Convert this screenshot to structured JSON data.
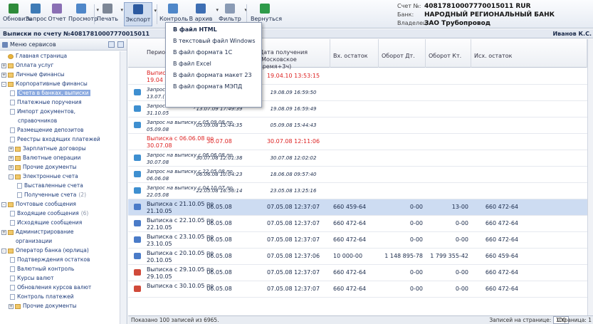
{
  "toolbar": {
    "buttons": [
      {
        "label": "Обновить",
        "color": "#2e8b3a"
      },
      {
        "label": "Запрос",
        "color": "#3e7bb6"
      },
      {
        "label": "Отчет",
        "color": "#8a6fb4"
      },
      {
        "label": "Просмотр",
        "color": "#4f87c9"
      },
      {
        "label": "Печать",
        "color": "#7d8796"
      },
      {
        "label": "Экспорт",
        "color": "#2c5aa0"
      },
      {
        "label": "Контроль",
        "color": "#4f87c9"
      },
      {
        "label": "В архив",
        "color": "#3e6fb4"
      },
      {
        "label": "Фильтр",
        "color": "#8a9bb5"
      },
      {
        "label": "Вернуться",
        "color": "#2e9b4a"
      }
    ]
  },
  "account": {
    "number_label": "Счет №:",
    "number": "40817810007770015011 RUR",
    "bank_label": "Банк:",
    "bank": "НАРОДНЫЙ РЕГИОНАЛЬНЫЙ БАНК",
    "owner_label": "Владелец:",
    "owner": "ЗАО Трубопровод"
  },
  "title": "Выписки по счету №40817810007770015011",
  "user": "Иванов К.С.",
  "export_menu": [
    "В файл HTML",
    "В текстовый файл Windows",
    "В файл формата 1С",
    "В файл Excel",
    "В файл формата макет 23",
    "В файл формата МЭПД"
  ],
  "sidebar": {
    "header": "Меню сервисов",
    "items": [
      {
        "label": "Главная страница",
        "lvl": 0,
        "icon": "star",
        "pm": ""
      },
      {
        "label": "Оплата услуг",
        "lvl": 0,
        "icon": "folder",
        "pm": "+"
      },
      {
        "label": "Личные финансы",
        "lvl": 0,
        "icon": "folder",
        "pm": "+"
      },
      {
        "label": "Корпоративные финансы",
        "lvl": 0,
        "icon": "folder",
        "pm": "-"
      },
      {
        "label": "Счета в банках, выписки",
        "lvl": 1,
        "icon": "page",
        "sel": true
      },
      {
        "label": "Платежные поручения",
        "lvl": 1,
        "icon": "page"
      },
      {
        "label": "Импорт документов,",
        "lvl": 1,
        "icon": "page"
      },
      {
        "label": "справочников",
        "lvl": 1,
        "icon": ""
      },
      {
        "label": "Размещение депозитов",
        "lvl": 1,
        "icon": "page"
      },
      {
        "label": "Реестры входящих платежей",
        "lvl": 1,
        "icon": "page"
      },
      {
        "label": "Зарплатные договоры",
        "lvl": 1,
        "icon": "folder",
        "pm": "+"
      },
      {
        "label": "Валютные операции",
        "lvl": 1,
        "icon": "folder",
        "pm": "+"
      },
      {
        "label": "Прочие документы",
        "lvl": 1,
        "icon": "folder",
        "pm": "+"
      },
      {
        "label": "Электронные счета",
        "lvl": 1,
        "icon": "folder",
        "pm": "-"
      },
      {
        "label": "Выставленные счета",
        "lvl": 2,
        "icon": "page"
      },
      {
        "label": "Полученные счета",
        "lvl": 2,
        "icon": "page",
        "count": "(2)"
      },
      {
        "label": "Почтовые сообщения",
        "lvl": 0,
        "icon": "folder",
        "pm": "-"
      },
      {
        "label": "Входящие сообщения",
        "lvl": 1,
        "icon": "page",
        "count": "(6)"
      },
      {
        "label": "Исходящие сообщения",
        "lvl": 1,
        "icon": "page"
      },
      {
        "label": "Администрирование",
        "lvl": 0,
        "icon": "folder",
        "pm": "+"
      },
      {
        "label": "организации",
        "lvl": 0,
        "icon": ""
      },
      {
        "label": "Оператор банка (юрлица)",
        "lvl": 0,
        "icon": "folder",
        "pm": "-"
      },
      {
        "label": "Подтверждения остатков",
        "lvl": 1,
        "icon": "page"
      },
      {
        "label": "Валютный контроль",
        "lvl": 1,
        "icon": "page"
      },
      {
        "label": "Курсы валют",
        "lvl": 1,
        "icon": "page"
      },
      {
        "label": "Обновления курсов валют",
        "lvl": 1,
        "icon": "page"
      },
      {
        "label": "Контроль платежей",
        "lvl": 1,
        "icon": "page"
      },
      {
        "label": "Прочие документы",
        "lvl": 1,
        "icon": "folder",
        "pm": "+"
      }
    ]
  },
  "grid": {
    "columns": [
      "Период",
      "Дата формирования (Московское время+3ч)",
      "Дата получения (Московское время+3ч)",
      "Вх. остаток",
      "Оборот Дт.",
      "Оборот Кт.",
      "Исх. остаток"
    ],
    "rows": [
      {
        "icon": "none",
        "period": "Выписк",
        "period2": "19.04",
        "formed": "19.04.10",
        "received": "19.04.10 13:53:15",
        "in": "",
        "dt": "",
        "kt": "",
        "out": "",
        "style": "red"
      },
      {
        "icon": "send",
        "period": "Запрос",
        "period2": "13.07.(",
        "formed": "13.07.09 18:37:05",
        "received": "19.08.09 16:59:50",
        "in": "",
        "dt": "",
        "kt": "",
        "out": "",
        "style": "it"
      },
      {
        "icon": "send",
        "period": "Запрос на выписку с 31.10.05 по",
        "period2": "31.10.05",
        "formed": "13.07.09 17:49:39",
        "received": "19.08.09 16:59:49",
        "in": "",
        "dt": "",
        "kt": "",
        "out": "",
        "style": "it"
      },
      {
        "icon": "send",
        "period": "Запрос на выписку с 05.09.08 по",
        "period2": "05.09.08",
        "formed": "05.09.08 15:44:35",
        "received": "05.09.08 15:44:43",
        "in": "",
        "dt": "",
        "kt": "",
        "out": "",
        "style": "it"
      },
      {
        "icon": "none",
        "period": "Выписка с 06.06.08 по",
        "period2": "30.07.08",
        "formed": "30.07.08",
        "received": "30.07.08 12:11:06",
        "in": "",
        "dt": "",
        "kt": "",
        "out": "",
        "style": "red"
      },
      {
        "icon": "send",
        "period": "Запрос на выписку с 06.06.08 по",
        "period2": "30.07.08",
        "formed": "30.07.08 12:01:38",
        "received": "30.07.08 12:02:02",
        "in": "",
        "dt": "",
        "kt": "",
        "out": "",
        "style": "it"
      },
      {
        "icon": "send",
        "period": "Запрос на выписку с 22.05.08 по",
        "period2": "06.06.08",
        "formed": "06.06.08 10:04:23",
        "received": "18.06.08 09:57:40",
        "in": "",
        "dt": "",
        "kt": "",
        "out": "",
        "style": "it"
      },
      {
        "icon": "send",
        "period": "Запрос на выписку с 04.10.07 по",
        "period2": "22.05.08",
        "formed": "22.05.08 16:56:14",
        "received": "23.05.08 13:25:16",
        "in": "",
        "dt": "",
        "kt": "",
        "out": "",
        "style": "it"
      },
      {
        "icon": "doc",
        "period": "Выписка с 21.10.05 по",
        "period2": "21.10.05",
        "formed": "06.05.08",
        "received": "07.05.08 12:37:07",
        "in": "660 459-64",
        "dt": "0-00",
        "kt": "13-00",
        "out": "660 472-64",
        "style": "sel"
      },
      {
        "icon": "doc",
        "period": "Выписка с 22.10.05 по",
        "period2": "22.10.05",
        "formed": "06.05.08",
        "received": "07.05.08 12:37:07",
        "in": "660 472-64",
        "dt": "0-00",
        "kt": "0-00",
        "out": "660 472-64",
        "style": ""
      },
      {
        "icon": "doc",
        "period": "Выписка с 23.10.05 по",
        "period2": "23.10.05",
        "formed": "06.05.08",
        "received": "07.05.08 12:37:07",
        "in": "660 472-64",
        "dt": "0-00",
        "kt": "0-00",
        "out": "660 472-64",
        "style": ""
      },
      {
        "icon": "doc",
        "period": "Выписка с 20.10.05 по",
        "period2": "20.10.05",
        "formed": "06.05.08",
        "received": "07.05.08 12:37:06",
        "in": "10 000-00",
        "dt": "1 148 895-78",
        "kt": "1 799 355-42",
        "out": "660 459-64",
        "style": ""
      },
      {
        "icon": "warn",
        "period": "Выписка с 29.10.05 по",
        "period2": "29.10.05",
        "formed": "06.05.08",
        "received": "07.05.08 12:37:07",
        "in": "660 472-64",
        "dt": "0-00",
        "kt": "0-00",
        "out": "660 472-64",
        "style": ""
      },
      {
        "icon": "warn",
        "period": "Выписка с 30.10.05 по",
        "period2": "",
        "formed": "06.05.08",
        "received": "07.05.08 12:37:07",
        "in": "660 472-64",
        "dt": "0-00",
        "kt": "0-00",
        "out": "660 472-64",
        "style": ""
      }
    ]
  },
  "status": {
    "shown": "Показано 100 записей из 6965.",
    "per_page_label": "Записей на странице:",
    "per_page": "100",
    "page_label": "Страница:",
    "page": "1"
  }
}
